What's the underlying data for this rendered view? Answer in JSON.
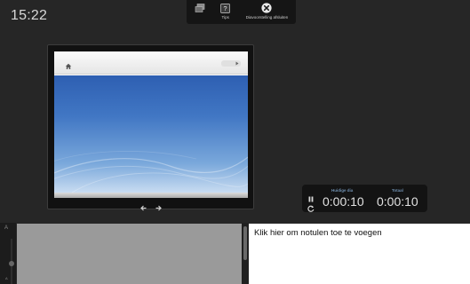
{
  "clock": {
    "time": "15:22"
  },
  "toolbar": {
    "buttons": [
      {
        "label": "",
        "icon": "slides-icon"
      },
      {
        "label": "Tips",
        "icon": "tips-icon",
        "glyph": "?"
      },
      {
        "label": "Diavoorstelling afsluiten",
        "icon": "close-icon"
      }
    ]
  },
  "timer": {
    "current_label": "Huidige dia",
    "current_value": "0:00:10",
    "total_label": "Totaal",
    "total_value": "0:00:10"
  },
  "notes": {
    "placeholder": "Klik hier om notulen toe te voegen"
  },
  "zoom_strip": {
    "top_label": "A",
    "bottom_label": "A"
  },
  "colors": {
    "background": "#262626",
    "timer_label": "#6f8fb0",
    "slide_blue": "#2e5fb2",
    "notes_left_panel": "#9a9a9a",
    "notes_right_panel": "#ffffff"
  }
}
